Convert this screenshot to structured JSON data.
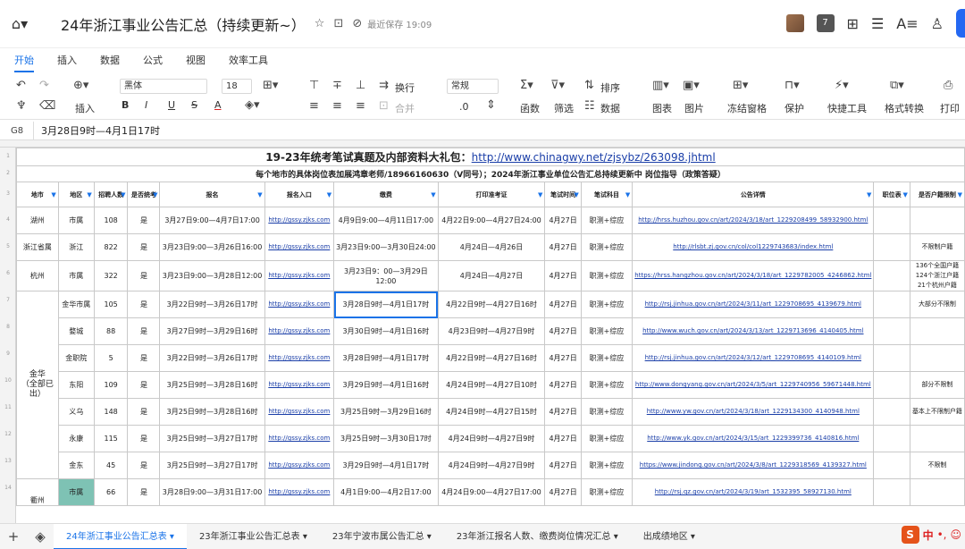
{
  "app": {
    "title": "24年浙江事业公告汇总（持续更新~）",
    "saved": "最近保存 19:09",
    "collab_count": "7"
  },
  "menus": [
    "开始",
    "插入",
    "数据",
    "公式",
    "视图",
    "效率工具"
  ],
  "ribbon": {
    "insert": "插入",
    "font": "黑体",
    "size": "18",
    "wrap": "换行",
    "merge": "合并",
    "numfmt": "常规",
    "decimal": ".0",
    "func": "函数",
    "filter": "筛选",
    "sort": "排序",
    "data": "数据",
    "chart": "图表",
    "image": "图片",
    "freeze": "冻结窗格",
    "protect": "保护",
    "quick": "快捷工具",
    "format": "格式转换",
    "print": "打印",
    "bold": "B",
    "italic": "I",
    "underline": "U",
    "strike": "S",
    "fontcolor": "A"
  },
  "formula": {
    "ref": "G8",
    "value": "3月28日9时—4月1日17时"
  },
  "sheet": {
    "title_text": "19-23年统考笔试真题及内部资料大礼包：",
    "title_link": "http://www.chinagwy.net/zjsybz/263098.jhtml",
    "subtitle": "每个地市的具体岗位表加展鸿章老师/18966160630（V同号）；2024年浙江事业单位公告汇总持续更新中  岗位指导（政策答疑）",
    "headers": [
      "地市",
      "地区",
      "招聘人数",
      "是否统考",
      "报名",
      "报名入口",
      "缴费",
      "打印准考证",
      "笔试时间",
      "笔试科目",
      "公告详情",
      "职位表",
      "是否户籍限制"
    ],
    "rows": [
      [
        "湖州",
        "市属",
        "108",
        "是",
        "3月27日9:00—4月7日17:00",
        "http://gssy.zjks.com",
        "4月9日9:00—4月11日17:00",
        "4月22日9:00—4月27日24:00",
        "4月27日",
        "职测+综应",
        "http://hrss.huzhou.gov.cn/art/2024/3/18/art_1229208499_58932900.html",
        "",
        ""
      ],
      [
        "浙江省属",
        "浙江",
        "822",
        "是",
        "3月23日9:00—3月26日16:00",
        "http://gssy.zjks.com",
        "3月23日9:00—3月30日24:00",
        "4月24日—4月26日",
        "4月27日",
        "职测+综应",
        "http://rlsbt.zj.gov.cn/col/col1229743683/index.html",
        "",
        "不限制户籍"
      ],
      [
        "杭州",
        "市属",
        "322",
        "是",
        "3月23日9:00—3月28日12:00",
        "http://gssy.zjks.com",
        "3月23日9：00—3月29日12:00",
        "4月24日—4月27日",
        "4月27日",
        "职测+综应",
        "https://hrss.hangzhou.gov.cn/art/2024/3/18/art_1229782005_4246862.html",
        "",
        "136个全国户籍 124个浙江户籍 21个杭州户籍"
      ],
      [
        "",
        "金华市属",
        "105",
        "是",
        "3月22日9时—3月26日17时",
        "http://gssy.zjks.com",
        "3月28日9时—4月1日17时",
        "4月22日9时—4月27日16时",
        "4月27日",
        "职测+综应",
        "http://rsj.jinhua.gov.cn/art/2024/3/11/art_1229708695_4139679.html",
        "",
        "大部分不限制"
      ],
      [
        "",
        "婺城",
        "88",
        "是",
        "3月27日9时—3月29日16时",
        "http://gssy.zjks.com",
        "3月30日9时—4月1日16时",
        "4月23日9时—4月27日9时",
        "4月27日",
        "职测+综应",
        "http://www.wuch.gov.cn/art/2024/3/13/art_1229713696_4140405.html",
        "",
        ""
      ],
      [
        "",
        "金职院",
        "5",
        "是",
        "3月22日9时—3月26日17时",
        "http://gssy.zjks.com",
        "3月28日9时—4月1日17时",
        "4月22日9时—4月27日16时",
        "4月27日",
        "职测+综应",
        "http://rsj.jinhua.gov.cn/art/2024/3/12/art_1229708695_4140109.html",
        "",
        ""
      ],
      [
        "",
        "东阳",
        "109",
        "是",
        "3月25日9时—3月28日16时",
        "http://gssy.zjks.com",
        "3月29日9时—4月1日16时",
        "4月24日9时—4月27日10时",
        "4月27日",
        "职测+综应",
        "http://www.dongyang.gov.cn/art/2024/3/5/art_1229740956_59671448.html",
        "",
        "部分不限制"
      ],
      [
        "",
        "义乌",
        "148",
        "是",
        "3月25日9时—3月28日16时",
        "http://gssy.zjks.com",
        "3月25日9时—3月29日16时",
        "4月24日9时—4月27日15时",
        "4月27日",
        "职测+综应",
        "http://www.yw.gov.cn/art/2024/3/18/art_1229134300_4140948.html",
        "",
        "基本上不限制户籍"
      ],
      [
        "",
        "永康",
        "115",
        "是",
        "3月25日9时—3月27日17时",
        "http://gssy.zjks.com",
        "3月25日9时—3月30日17时",
        "4月24日9时—4月27日9时",
        "4月27日",
        "职测+综应",
        "http://www.yk.gov.cn/art/2024/3/15/art_1229399736_4140816.html",
        "",
        ""
      ],
      [
        "",
        "金东",
        "45",
        "是",
        "3月25日9时—3月27日17时",
        "http://gssy.zjks.com",
        "3月29日9时—4月1日17时",
        "4月24日9时—4月27日9时",
        "4月27日",
        "职测+综应",
        "https://www.jindong.gov.cn/art/2024/3/8/art_1229318569_4139327.html",
        "",
        "不限制"
      ],
      [
        "衢州",
        "市属",
        "66",
        "是",
        "3月28日9:00—3月31日17:00",
        "http://gssy.zjks.com",
        "4月1日9:00—4月2日17:00",
        "4月24日9:00—4月27日17:00",
        "4月27日",
        "职测+综应",
        "http://rsj.qz.gov.cn/art/2024/3/19/art_1532395_58927130.html",
        "",
        ""
      ]
    ],
    "jinhua_label": "金华\n（全部已出）"
  },
  "tabs": [
    "24年浙江事业公告汇总表",
    "23年浙江事业公告汇总表",
    "23年宁波市属公告汇总",
    "23年浙江报名人数、缴费岗位情况汇总",
    "出成绩地区"
  ],
  "ime": {
    "lang": "中"
  },
  "colors": {
    "accent": "#1a73e8",
    "link": "#1a3ea8",
    "highlight": "#7ec2b4"
  }
}
